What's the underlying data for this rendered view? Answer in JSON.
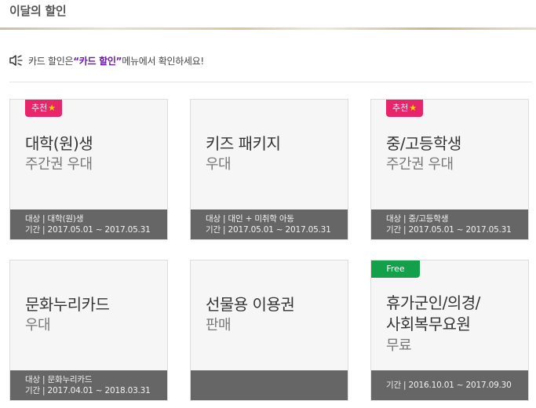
{
  "page": {
    "title": "이달의 할인",
    "notice_pre": "카드 할인은 ",
    "notice_highlight": "“카드 할인”",
    "notice_post": " 메뉴에서 확인하세요!"
  },
  "cards": [
    {
      "badge": "추천",
      "title": "대학(원)생",
      "subtitle": "주간권 우대",
      "target": "대상 | 대학(원)생",
      "period": "기간 | 2017.05.01 ~ 2017.05.31"
    },
    {
      "badge": "",
      "title": "키즈 패키지",
      "subtitle": "우대",
      "target": "대상 | 대인 + 미취학 아동",
      "period": "기간 | 2017.05.01 ~ 2017.05.31"
    },
    {
      "badge": "추천",
      "title": "중/고등학생",
      "subtitle": "주간권 우대",
      "target": "대상 | 중/고등학생",
      "period": "기간 | 2017.05.01 ~ 2017.05.31"
    },
    {
      "badge": "",
      "title": "문화누리카드",
      "subtitle": "우대",
      "target": "대상 | 문화누리카드",
      "period": "기간 | 2017.04.01 ~ 2018.03.31"
    },
    {
      "badge": "",
      "title": "선물용 이용권",
      "subtitle": "판매",
      "target": "",
      "period": ""
    },
    {
      "badge": "Free",
      "title": "휴가군인/의경/",
      "title2": "사회복무요원",
      "subtitle": "무료",
      "target": "",
      "period": "기간 | 2016.10.01 ~ 2017.09.30"
    }
  ],
  "colors": {
    "recommend_badge": "#e8246a",
    "free_badge": "#14a04a",
    "highlight": "#6a1aa8",
    "info_bar": "#666666"
  },
  "icons": {
    "notice": "speaker-icon",
    "badge": "star-icon"
  }
}
